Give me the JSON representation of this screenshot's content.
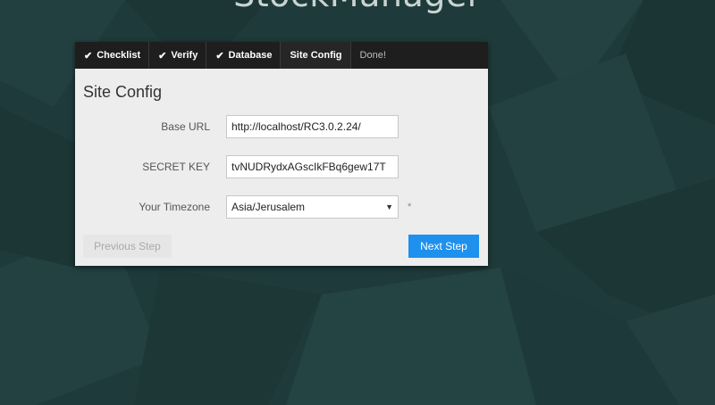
{
  "app": {
    "title": "StockManager"
  },
  "steps": [
    {
      "label": "Checklist",
      "state": "done",
      "icon": "check-icon"
    },
    {
      "label": "Verify",
      "state": "done",
      "icon": "check-icon"
    },
    {
      "label": "Database",
      "state": "done",
      "icon": "check-icon"
    },
    {
      "label": "Site Config",
      "state": "active"
    },
    {
      "label": "Done!",
      "state": "pending"
    }
  ],
  "form": {
    "title": "Site Config",
    "base_url": {
      "label": "Base URL",
      "value": "http://localhost/RC3.0.2.24/"
    },
    "secret_key": {
      "label": "SECRET KEY",
      "value": "tvNUDRydxAGscIkFBq6gew17T"
    },
    "timezone": {
      "label": "Your Timezone",
      "value": "Asia/Jerusalem",
      "required_mark": "*"
    }
  },
  "buttons": {
    "previous": "Previous Step",
    "next": "Next Step"
  },
  "colors": {
    "background": "#1f3a3a",
    "panel": "#ededed",
    "nav": "#1e1e1e",
    "primary": "#1e90ee"
  }
}
